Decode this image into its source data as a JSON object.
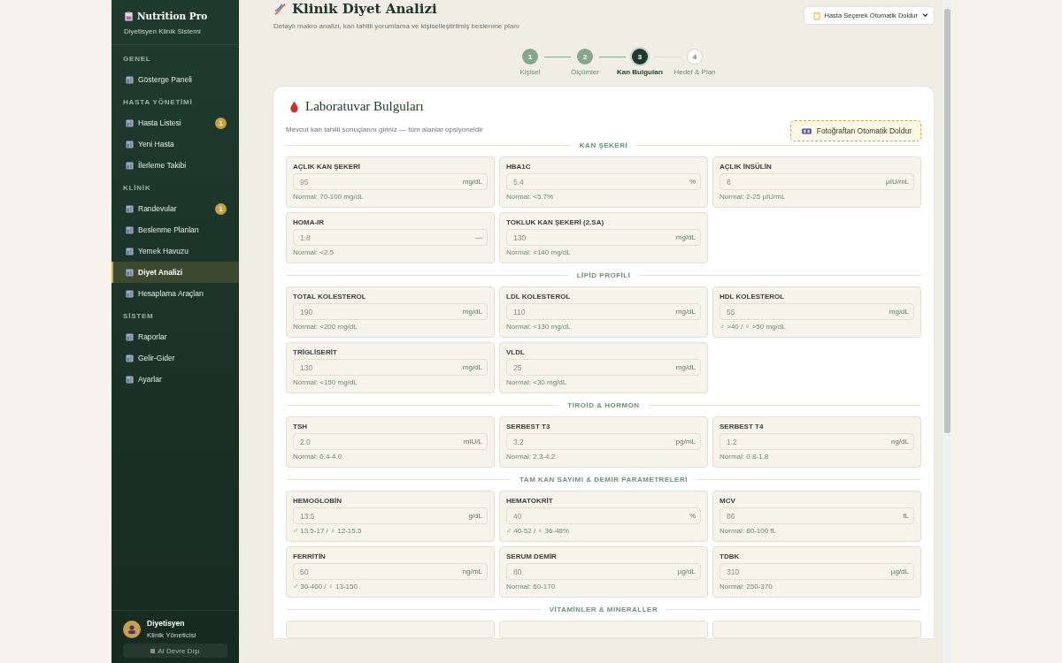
{
  "sidebar": {
    "brand": "Nutrition Pro",
    "tagline": "Diyetisyen Klinik Sistemi",
    "sections": [
      {
        "title": "GENEL",
        "items": [
          {
            "label": "Gösterge Paneli",
            "selected": false
          }
        ]
      },
      {
        "title": "HASTA YÖNETİMİ",
        "items": [
          {
            "label": "Hasta Listesi",
            "selected": false,
            "badge": "1"
          },
          {
            "label": "Yeni Hasta",
            "selected": false
          },
          {
            "label": "İlerleme Takibi",
            "selected": false
          }
        ]
      },
      {
        "title": "KLİNİK",
        "items": [
          {
            "label": "Randevular",
            "selected": false,
            "badge": "1"
          },
          {
            "label": "Beslenme Planları",
            "selected": false
          },
          {
            "label": "Yemek Havuzu",
            "selected": false
          },
          {
            "label": "Diyet Analizi",
            "selected": true
          },
          {
            "label": "Hesaplama Araçları",
            "selected": false
          }
        ]
      },
      {
        "title": "SİSTEM",
        "items": [
          {
            "label": "Raporlar",
            "selected": false
          },
          {
            "label": "Gelir-Gider",
            "selected": false
          },
          {
            "label": "Ayarlar",
            "selected": false
          }
        ]
      }
    ],
    "user": {
      "name": "Diyetisyen",
      "role": "Klinik Yöneticisi",
      "ai_toggle": {
        "label": "AI Devre Dışı",
        "checked": false
      }
    }
  },
  "header": {
    "title": "Klinik Diyet Analizi",
    "subtitle": "Detaylı makro analizi, kan tahlili yorumlama ve kişiselleştirilmiş beslenme planı",
    "patient_select": {
      "value": "Hasta Seçerek Otomatik Doldur"
    }
  },
  "steps": [
    {
      "number": "1",
      "label": "Kişisel",
      "done": true,
      "selected": false
    },
    {
      "number": "2",
      "label": "Ölçümler",
      "done": true,
      "selected": false
    },
    {
      "number": "3",
      "label": "Kan Bulguları",
      "done": false,
      "selected": true
    },
    {
      "number": "4",
      "label": "Hedef & Plan",
      "done": false,
      "selected": false
    }
  ],
  "card": {
    "title": "Laboratuvar Bulguları",
    "subtitle": "Mevcut kan tahlili sonuçlarını giriniz — tüm alanlar opsiyoneldir",
    "photo_button": "Fotoğraftan Otomatik Doldur",
    "sections": [
      {
        "title": "KAN ŞEKERİ",
        "fields": [
          {
            "label": "AÇLIK KAN ŞEKERİ",
            "placeholder": "95",
            "unit": "mg/dL",
            "hint": "Normal: 70-100 mg/dL"
          },
          {
            "label": "HBA1C",
            "placeholder": "5.4",
            "unit": "%",
            "hint": "Normal: <5.7%"
          },
          {
            "label": "AÇLIK İNSÜLİN",
            "placeholder": "8",
            "unit": "µIU/mL",
            "hint": "Normal: 2-25 µIU/mL"
          },
          {
            "label": "HOMA-IR",
            "placeholder": "1.8",
            "unit": "—",
            "hint": "Normal: <2.5"
          },
          {
            "label": "TOKLUK KAN ŞEKERİ (2.SA)",
            "placeholder": "130",
            "unit": "mg/dL",
            "hint": "Normal: <140 mg/dL"
          }
        ]
      },
      {
        "title": "LİPİD PROFİLİ",
        "fields": [
          {
            "label": "TOTAL KOLESTEROL",
            "placeholder": "190",
            "unit": "mg/dL",
            "hint": "Normal: <200 mg/dL"
          },
          {
            "label": "LDL KOLESTEROL",
            "placeholder": "110",
            "unit": "mg/dL",
            "hint": "Normal: <130 mg/dL"
          },
          {
            "label": "HDL KOLESTEROL",
            "placeholder": "55",
            "unit": "mg/dL",
            "hint": "♂ >40 / ♀ >50 mg/dL"
          },
          {
            "label": "TRİGLİSERİT",
            "placeholder": "130",
            "unit": "mg/dL",
            "hint": "Normal: <150 mg/dL"
          },
          {
            "label": "VLDL",
            "placeholder": "25",
            "unit": "mg/dL",
            "hint": "Normal: <30 mg/dL"
          }
        ]
      },
      {
        "title": "TİROİD & HORMON",
        "fields": [
          {
            "label": "TSH",
            "placeholder": "2.0",
            "unit": "mIU/L",
            "hint": "Normal: 0.4-4.0"
          },
          {
            "label": "SERBEST T3",
            "placeholder": "3.2",
            "unit": "pg/mL",
            "hint": "Normal: 2.3-4.2"
          },
          {
            "label": "SERBEST T4",
            "placeholder": "1.2",
            "unit": "ng/dL",
            "hint": "Normal: 0.8-1.8"
          }
        ]
      },
      {
        "title": "TAM KAN SAYIMI & DEMİR PARAMETRELERİ",
        "fields": [
          {
            "label": "HEMOGLOBİN",
            "placeholder": "13.5",
            "unit": "g/dL",
            "hint": "♂ 13.5-17 / ♀ 12-15.5"
          },
          {
            "label": "HEMATOKRİT",
            "placeholder": "40",
            "unit": "%",
            "hint": "♂ 40-52 / ♀ 36-48%"
          },
          {
            "label": "MCV",
            "placeholder": "86",
            "unit": "fL",
            "hint": "Normal: 80-100 fL"
          },
          {
            "label": "FERRİTİN",
            "placeholder": "50",
            "unit": "ng/mL",
            "hint": "♂ 30-400 / ♀ 13-150"
          },
          {
            "label": "SERUM DEMİR",
            "placeholder": "80",
            "unit": "µg/dL",
            "hint": "Normal: 60-170"
          },
          {
            "label": "TDBK",
            "placeholder": "310",
            "unit": "µg/dL",
            "hint": "Normal: 250-370"
          }
        ]
      },
      {
        "title": "VİTAMİNLER & MİNERALLER"
      }
    ]
  }
}
